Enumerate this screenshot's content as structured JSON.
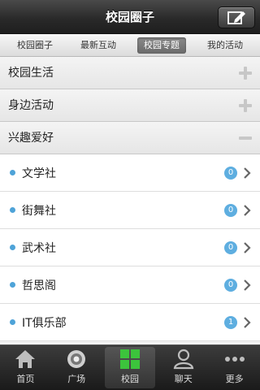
{
  "header": {
    "title": "校园圈子",
    "compose_icon": "compose-icon"
  },
  "tabs": [
    {
      "label": "校园圈子",
      "active": false
    },
    {
      "label": "最新互动",
      "active": false
    },
    {
      "label": "校园专题",
      "active": true
    },
    {
      "label": "我的活动",
      "active": false
    }
  ],
  "sections": [
    {
      "label": "校园生活",
      "state": "collapsed"
    },
    {
      "label": "身边活动",
      "state": "collapsed"
    },
    {
      "label": "兴趣爱好",
      "state": "expanded"
    }
  ],
  "clubs": [
    {
      "label": "文学社",
      "count": "0"
    },
    {
      "label": "街舞社",
      "count": "0"
    },
    {
      "label": "武术社",
      "count": "0"
    },
    {
      "label": "哲思阁",
      "count": "0"
    },
    {
      "label": "IT俱乐部",
      "count": "1"
    }
  ],
  "bottom_nav": [
    {
      "label": "首页",
      "icon": "home-icon",
      "active": false
    },
    {
      "label": "广场",
      "icon": "square-icon",
      "active": false
    },
    {
      "label": "校园",
      "icon": "campus-grid-icon",
      "active": true
    },
    {
      "label": "聊天",
      "icon": "chat-user-icon",
      "active": false
    },
    {
      "label": "更多",
      "icon": "more-icon",
      "active": false
    }
  ],
  "colors": {
    "accent": "#5eaee0",
    "campus_icon": "#3cc43c"
  }
}
